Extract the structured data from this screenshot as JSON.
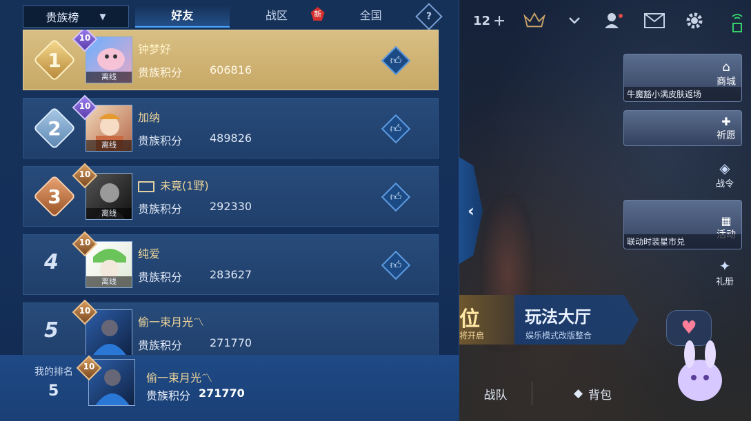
{
  "panel": {
    "dropdown_label": "贵族榜",
    "tabs": [
      {
        "label": "好友"
      },
      {
        "label": "战区",
        "badge": "新"
      },
      {
        "label": "全国"
      }
    ],
    "help_glyph": "?"
  },
  "entries": [
    {
      "rank": "1",
      "level": "10",
      "name": "钟梦好",
      "score_label": "贵族积分",
      "score": "606816",
      "status": "离线"
    },
    {
      "rank": "2",
      "level": "10",
      "name": "加纳",
      "score_label": "贵族积分",
      "score": "489826",
      "status": "离线"
    },
    {
      "rank": "3",
      "level": "10",
      "name": "未竟(1野)",
      "score_label": "贵族积分",
      "score": "292330",
      "status": "离线"
    },
    {
      "rank": "4",
      "level": "10",
      "name": "纯爱",
      "score_label": "贵族积分",
      "score": "283627",
      "status": "离线"
    },
    {
      "rank": "5",
      "level": "10",
      "name": "偷一束月光〽",
      "score_label": "贵族积分",
      "score": "271770",
      "status": ""
    }
  ],
  "my_rank": {
    "label": "我的排名",
    "rank": "5",
    "level": "10",
    "name": "偷一束月光〽",
    "score_label": "贵族积分",
    "score": "271770"
  },
  "topbar": {
    "count": "12"
  },
  "side": {
    "shop_caption": "牛魔豁小满皮肤返场",
    "shop_label": "商城",
    "wish_label": "祈愿",
    "battlepass_label": "战令",
    "event_caption": "联动时装星市兑",
    "event_label": "活动",
    "gift_label": "礼册"
  },
  "hall": {
    "left_big": "位",
    "left_small": "将开启",
    "title": "玩法大厅",
    "subtitle": "娱乐模式改版整合"
  },
  "bottom_nav": {
    "team": "战队",
    "bag": "背包"
  }
}
